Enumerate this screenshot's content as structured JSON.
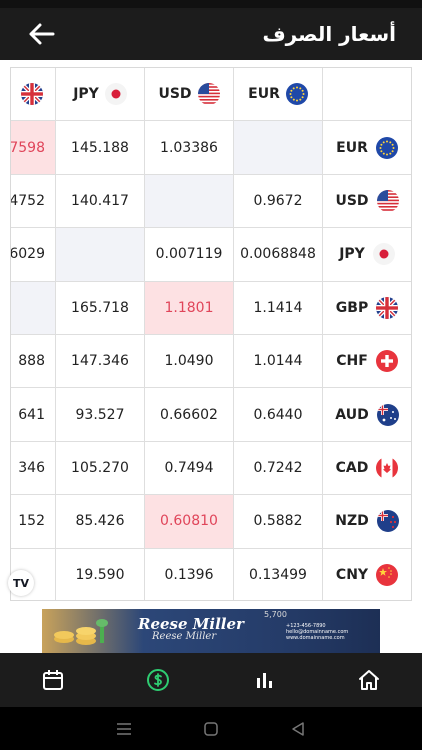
{
  "app": {
    "title": "أسعار الصرف",
    "back_icon": "arrow-left-icon"
  },
  "table": {
    "columns": [
      {
        "code": "",
        "flag": "gb"
      },
      {
        "code": "JPY",
        "flag": "jp"
      },
      {
        "code": "USD",
        "flag": "us"
      },
      {
        "code": "EUR",
        "flag": "eu"
      }
    ],
    "rows": [
      {
        "code": "EUR",
        "flag": "eu",
        "cells": [
          {
            "v": "7598",
            "s": "hl"
          },
          {
            "v": "145.188",
            "s": ""
          },
          {
            "v": "1.03386",
            "s": ""
          },
          {
            "v": "",
            "s": "self"
          }
        ]
      },
      {
        "code": "USD",
        "flag": "us",
        "cells": [
          {
            "v": "4752",
            "s": ""
          },
          {
            "v": "140.417",
            "s": ""
          },
          {
            "v": "",
            "s": "self"
          },
          {
            "v": "0.9672",
            "s": ""
          }
        ]
      },
      {
        "code": "JPY",
        "flag": "jp",
        "cells": [
          {
            "v": "6029",
            "s": ""
          },
          {
            "v": "",
            "s": "self"
          },
          {
            "v": "0.007119",
            "s": ""
          },
          {
            "v": "0.0068848",
            "s": ""
          }
        ]
      },
      {
        "code": "GBP",
        "flag": "gb",
        "cells": [
          {
            "v": "",
            "s": "self"
          },
          {
            "v": "165.718",
            "s": ""
          },
          {
            "v": "1.1801",
            "s": "hl"
          },
          {
            "v": "1.1414",
            "s": ""
          }
        ]
      },
      {
        "code": "CHF",
        "flag": "ch",
        "cells": [
          {
            "v": "888",
            "s": ""
          },
          {
            "v": "147.346",
            "s": ""
          },
          {
            "v": "1.0490",
            "s": ""
          },
          {
            "v": "1.0144",
            "s": ""
          }
        ]
      },
      {
        "code": "AUD",
        "flag": "au",
        "cells": [
          {
            "v": "641",
            "s": ""
          },
          {
            "v": "93.527",
            "s": ""
          },
          {
            "v": "0.66602",
            "s": ""
          },
          {
            "v": "0.6440",
            "s": ""
          }
        ]
      },
      {
        "code": "CAD",
        "flag": "ca",
        "cells": [
          {
            "v": "346",
            "s": ""
          },
          {
            "v": "105.270",
            "s": ""
          },
          {
            "v": "0.7494",
            "s": ""
          },
          {
            "v": "0.7242",
            "s": ""
          }
        ]
      },
      {
        "code": "NZD",
        "flag": "nz",
        "cells": [
          {
            "v": "152",
            "s": ""
          },
          {
            "v": "85.426",
            "s": ""
          },
          {
            "v": "0.60810",
            "s": "hl"
          },
          {
            "v": "0.5882",
            "s": ""
          }
        ]
      },
      {
        "code": "CNY",
        "flag": "cn",
        "cells": [
          {
            "v": "",
            "s": ""
          },
          {
            "v": "19.590",
            "s": ""
          },
          {
            "v": "0.1396",
            "s": ""
          },
          {
            "v": "0.13499",
            "s": ""
          }
        ]
      }
    ]
  },
  "tradingview_badge": "TV",
  "ad": {
    "name": "Reese Miller",
    "name_small": "Reese Miller",
    "number": "5,700",
    "phone": "+123-456-7890",
    "email": "hello@domainname.com",
    "website": "www.domainname.com"
  },
  "bottom_nav": [
    {
      "icon": "calendar-icon",
      "active": false
    },
    {
      "icon": "currency-dollar-icon",
      "active": true
    },
    {
      "icon": "bar-chart-icon",
      "active": false
    },
    {
      "icon": "home-icon",
      "active": false
    }
  ],
  "colors": {
    "appbar": "#1c1c1c",
    "highlight_bg": "#fde1e3",
    "highlight_text": "#e0455a",
    "active_nav": "#2ecc71"
  }
}
